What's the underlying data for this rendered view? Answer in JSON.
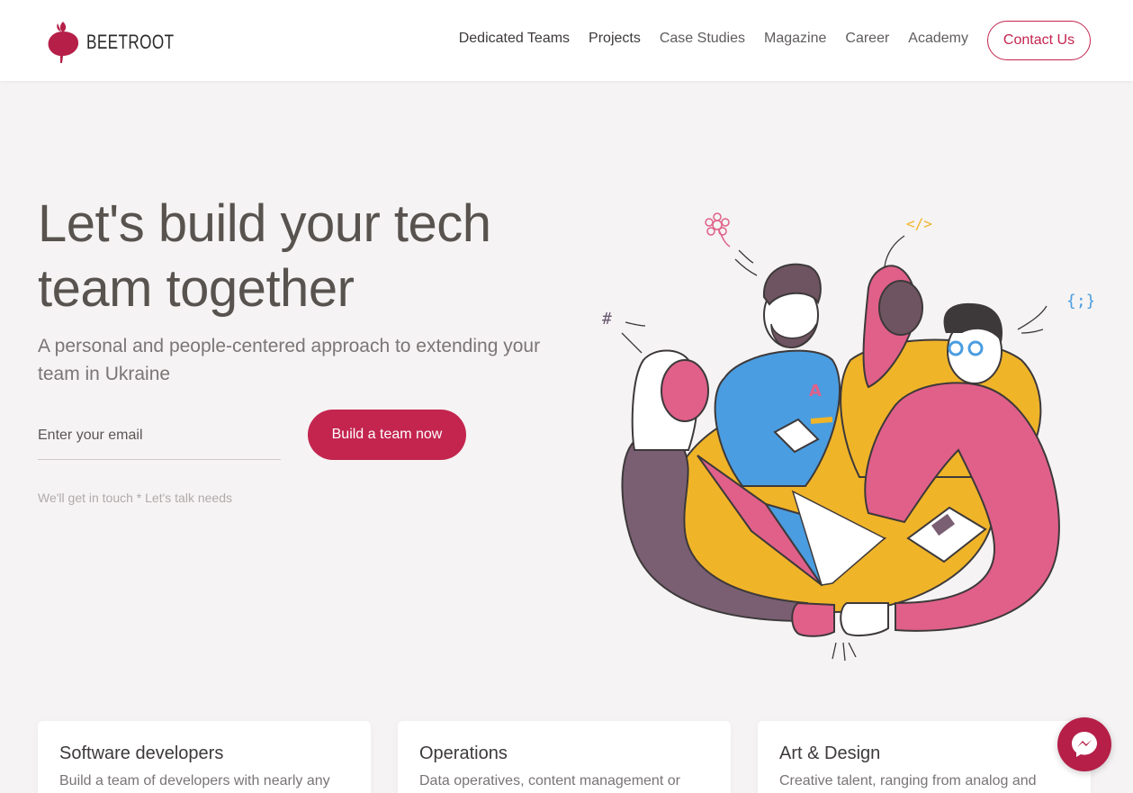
{
  "brand": {
    "name": "BEETROOT",
    "accent": "#c3254f"
  },
  "nav": {
    "items": [
      {
        "label": "Dedicated Teams"
      },
      {
        "label": "Projects"
      },
      {
        "label": "Case Studies"
      },
      {
        "label": "Magazine"
      },
      {
        "label": "Career"
      },
      {
        "label": "Academy"
      }
    ],
    "contact_label": "Contact Us"
  },
  "hero": {
    "title_line1": "Let's build your tech",
    "title_line2": "team together",
    "subtitle": "A personal and people-centered approach to extending your team in Ukraine",
    "email_placeholder": "Enter your email",
    "cta_label": "Build a team now",
    "hint": "We'll get in touch * Let's talk needs"
  },
  "illustration": {
    "code_symbols": [
      "#",
      "</>",
      "{;}"
    ]
  },
  "cards": [
    {
      "title": "Software developers",
      "text": "Build a team of developers with nearly any"
    },
    {
      "title": "Operations",
      "text": "Data operatives, content management or"
    },
    {
      "title": "Art & Design",
      "text": "Creative talent, ranging from analog and"
    }
  ],
  "icons": {
    "logo": "beetroot-icon",
    "chat": "messenger-icon"
  }
}
